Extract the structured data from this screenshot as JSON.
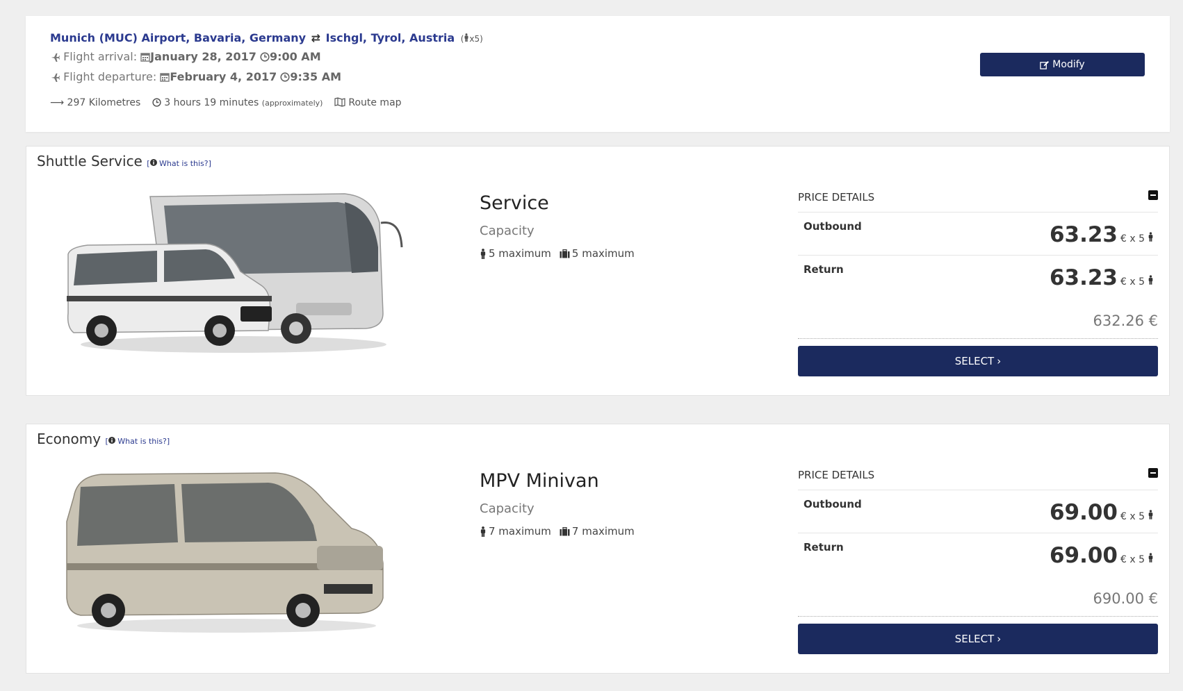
{
  "summary": {
    "origin": "Munich (MUC) Airport, Bavaria, Germany",
    "destination": "Ischgl, Tyrol, Austria",
    "passengers": "(",
    "passengers_count": "x5)",
    "arrival_label": "Flight arrival:",
    "arrival_date": "January 28, 2017",
    "arrival_time": "9:00 AM",
    "departure_label": "Flight departure:",
    "departure_date": "February 4, 2017",
    "departure_time": "9:35 AM",
    "distance": "297 Kilometres",
    "duration": "3 hours 19 minutes",
    "duration_note": "(approximately)",
    "route_map": "Route map",
    "modify_label": "Modify"
  },
  "options": [
    {
      "category": "Shuttle Service",
      "what_is_this": "What is this?]",
      "what_prefix": "[",
      "vehicle": "Service",
      "capacity_label": "Capacity",
      "persons": "5 maximum",
      "luggage": "5 maximum",
      "price_details_label": "PRICE DETAILS",
      "outbound_label": "Outbound",
      "outbound_price": "63.23",
      "outbound_unit": "€ x 5",
      "return_label": "Return",
      "return_price": "63.23",
      "return_unit": "€ x 5",
      "total": "632.26 €",
      "select_label": "SELECT"
    },
    {
      "category": "Economy",
      "what_is_this": "What is this?]",
      "what_prefix": "[",
      "vehicle": "MPV Minivan",
      "capacity_label": "Capacity",
      "persons": "7 maximum",
      "luggage": "7 maximum",
      "price_details_label": "PRICE DETAILS",
      "outbound_label": "Outbound",
      "outbound_price": "69.00",
      "outbound_unit": "€ x 5",
      "return_label": "Return",
      "return_price": "69.00",
      "return_unit": "€ x 5",
      "total": "690.00 €",
      "select_label": "SELECT"
    }
  ],
  "colors": {
    "accent": "#1b2a5e",
    "link": "#2b3a8f",
    "background": "#efefef"
  },
  "icons": [
    "exchange-icon",
    "person-icon",
    "plane-icon",
    "calendar-icon",
    "clock-icon",
    "arrow-right-icon",
    "map-icon",
    "edit-icon",
    "info-icon",
    "suitcase-icon",
    "minus-square-icon",
    "chevron-right-icon"
  ]
}
